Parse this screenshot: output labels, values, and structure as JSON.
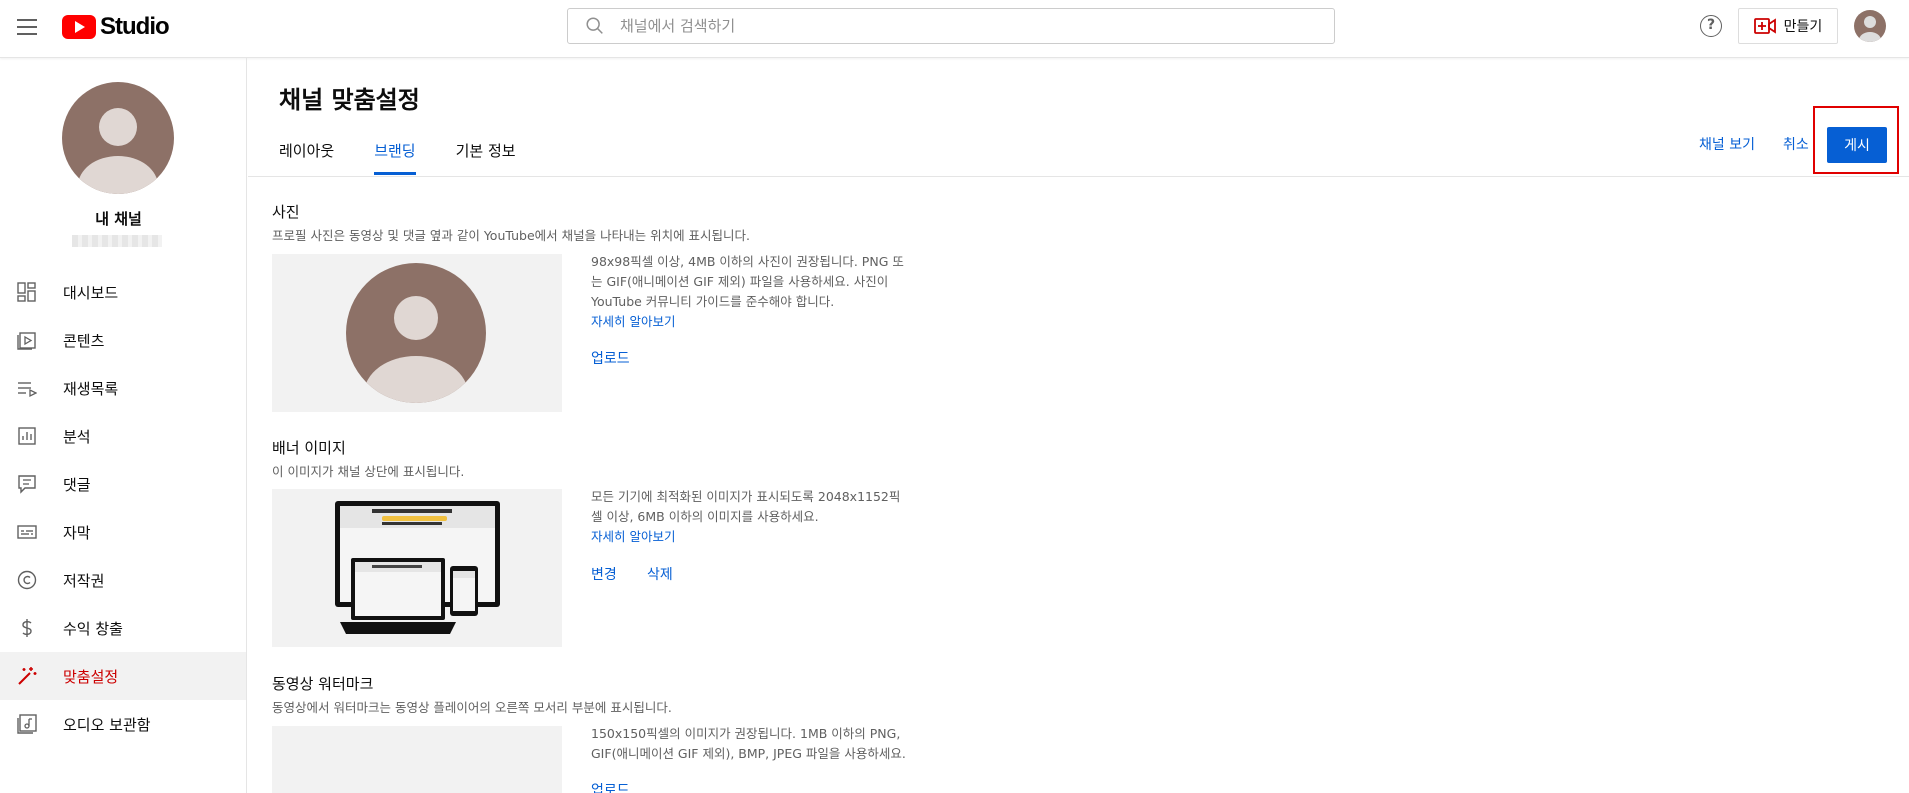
{
  "header": {
    "logo_text": "Studio",
    "search_placeholder": "채널에서 검색하기",
    "help_label": "?",
    "create_label": "만들기"
  },
  "sidebar": {
    "channel_name": "내 채널",
    "items": [
      {
        "label": "대시보드",
        "icon": "dashboard-icon"
      },
      {
        "label": "콘텐츠",
        "icon": "content-icon"
      },
      {
        "label": "재생목록",
        "icon": "playlist-icon"
      },
      {
        "label": "분석",
        "icon": "analytics-icon"
      },
      {
        "label": "댓글",
        "icon": "comments-icon"
      },
      {
        "label": "자막",
        "icon": "subtitles-icon"
      },
      {
        "label": "저작권",
        "icon": "copyright-icon"
      },
      {
        "label": "수익 창출",
        "icon": "dollar-icon"
      },
      {
        "label": "맞춤설정",
        "icon": "magic-wand-icon",
        "active": true
      },
      {
        "label": "오디오 보관함",
        "icon": "audio-library-icon"
      }
    ]
  },
  "main": {
    "title": "채널 맞춤설정",
    "tabs": [
      {
        "label": "레이아웃"
      },
      {
        "label": "브랜딩",
        "active": true
      },
      {
        "label": "기본 정보"
      }
    ],
    "view_channel_label": "채널 보기",
    "cancel_label": "취소",
    "publish_label": "게시",
    "photo": {
      "title": "사진",
      "desc": "프로필 사진은 동영상 및 댓글 옆과 같이 YouTube에서 채널을 나타내는 위치에 표시됩니다.",
      "info_lines": [
        "98x98픽셀 이상, 4MB 이하의 사진이 권장됩니다. PNG 또",
        "는 GIF(애니메이션 GIF 제외) 파일을 사용하세요. 사진이",
        "YouTube 커뮤니티 가이드를 준수해야 합니다."
      ],
      "learn_more": "자세히 알아보기",
      "upload_label": "업로드"
    },
    "banner": {
      "title": "배너 이미지",
      "desc": "이 이미지가 채널 상단에 표시됩니다.",
      "info_lines": [
        "모든 기기에 최적화된 이미지가 표시되도록 2048x1152픽",
        "셀 이상, 6MB 이하의 이미지를 사용하세요."
      ],
      "learn_more": "자세히 알아보기",
      "change_label": "변경",
      "delete_label": "삭제"
    },
    "watermark": {
      "title": "동영상 워터마크",
      "desc": "동영상에서 워터마크는 동영상 플레이어의 오른쪽 모서리 부분에 표시됩니다.",
      "info_lines": [
        "150x150픽셀의 이미지가 권장됩니다. 1MB 이하의 PNG,",
        "GIF(애니메이션 GIF 제외), BMP, JPEG 파일을 사용하세요."
      ],
      "upload_label": "업로드"
    }
  },
  "colors": {
    "accent": "#065fd4",
    "brand_red": "#ff0000",
    "active_nav": "#cc0000",
    "highlight_box": "#e00000",
    "avatar": "#8d7167"
  }
}
